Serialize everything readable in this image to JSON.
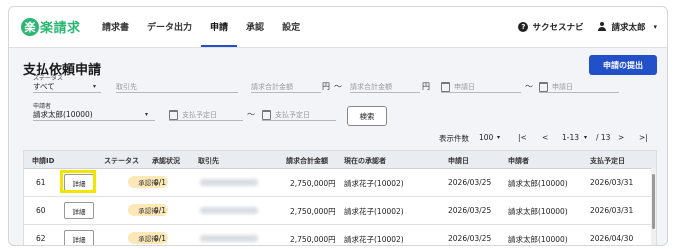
{
  "app": {
    "logo_mark": "楽",
    "logo_text": "楽請求"
  },
  "nav": {
    "items": [
      {
        "label": "請求書"
      },
      {
        "label": "データ出力"
      },
      {
        "label": "申請"
      },
      {
        "label": "承認"
      },
      {
        "label": "設定"
      }
    ],
    "active": "申請"
  },
  "topbar": {
    "help_label": "サクセスナビ",
    "help_glyph": "?",
    "user_name": "請求太郎",
    "caret": "▾"
  },
  "page": {
    "title": "支払依頼申請",
    "submit_label": "申請の提出"
  },
  "filters": {
    "status_label": "ステータス",
    "status_value": "すべて",
    "supplier_placeholder": "取引先",
    "amount_min_placeholder": "請求合計金額",
    "amount_max_placeholder": "請求合計金額",
    "yen": "円",
    "tilde": "〜",
    "apply_from_placeholder": "申請日",
    "apply_to_placeholder": "申請日",
    "applicant_label": "申請者",
    "applicant_value": "請求太郎(10000)",
    "payment_from_placeholder": "支払予定日",
    "payment_to_placeholder": "支払予定日",
    "search_label": "検索",
    "caret": "▾"
  },
  "pager": {
    "count_label": "表示件数",
    "count_value": "100",
    "range": "1-13",
    "total": "/ 13",
    "first": "|<",
    "prev": "<",
    "next": ">",
    "last": ">|"
  },
  "table": {
    "headers": [
      "申請ID",
      "",
      "ステータス",
      "承認状況",
      "取引先",
      "請求合計金額",
      "現在の承認者",
      "申請日",
      "申請者",
      "支払予定日"
    ],
    "rows": [
      {
        "id": "61",
        "detail": "詳細",
        "status": "承認待",
        "progress": "0/1",
        "amount": "2,750,000円",
        "approver": "請求花子(10002)",
        "applied": "2026/03/25",
        "applicant": "請求太郎(10000)",
        "due": "2026/03/31"
      },
      {
        "id": "60",
        "detail": "詳細",
        "status": "承認待",
        "progress": "0/1",
        "amount": "2,750,000円",
        "approver": "請求花子(10002)",
        "applied": "2026/03/25",
        "applicant": "請求太郎(10000)",
        "due": "2026/03/31"
      },
      {
        "id": "62",
        "detail": "詳細",
        "status": "承認待",
        "progress": "0/1",
        "amount": "2,750,000円",
        "approver": "請求花子(10002)",
        "applied": "2026/03/25",
        "applicant": "請求太郎(10000)",
        "due": "2026/04/30"
      }
    ]
  },
  "colors": {
    "accent": "#2250c8",
    "brand": "#2bb673",
    "badge": "#fde9b8",
    "highlight": "#f2e600"
  }
}
